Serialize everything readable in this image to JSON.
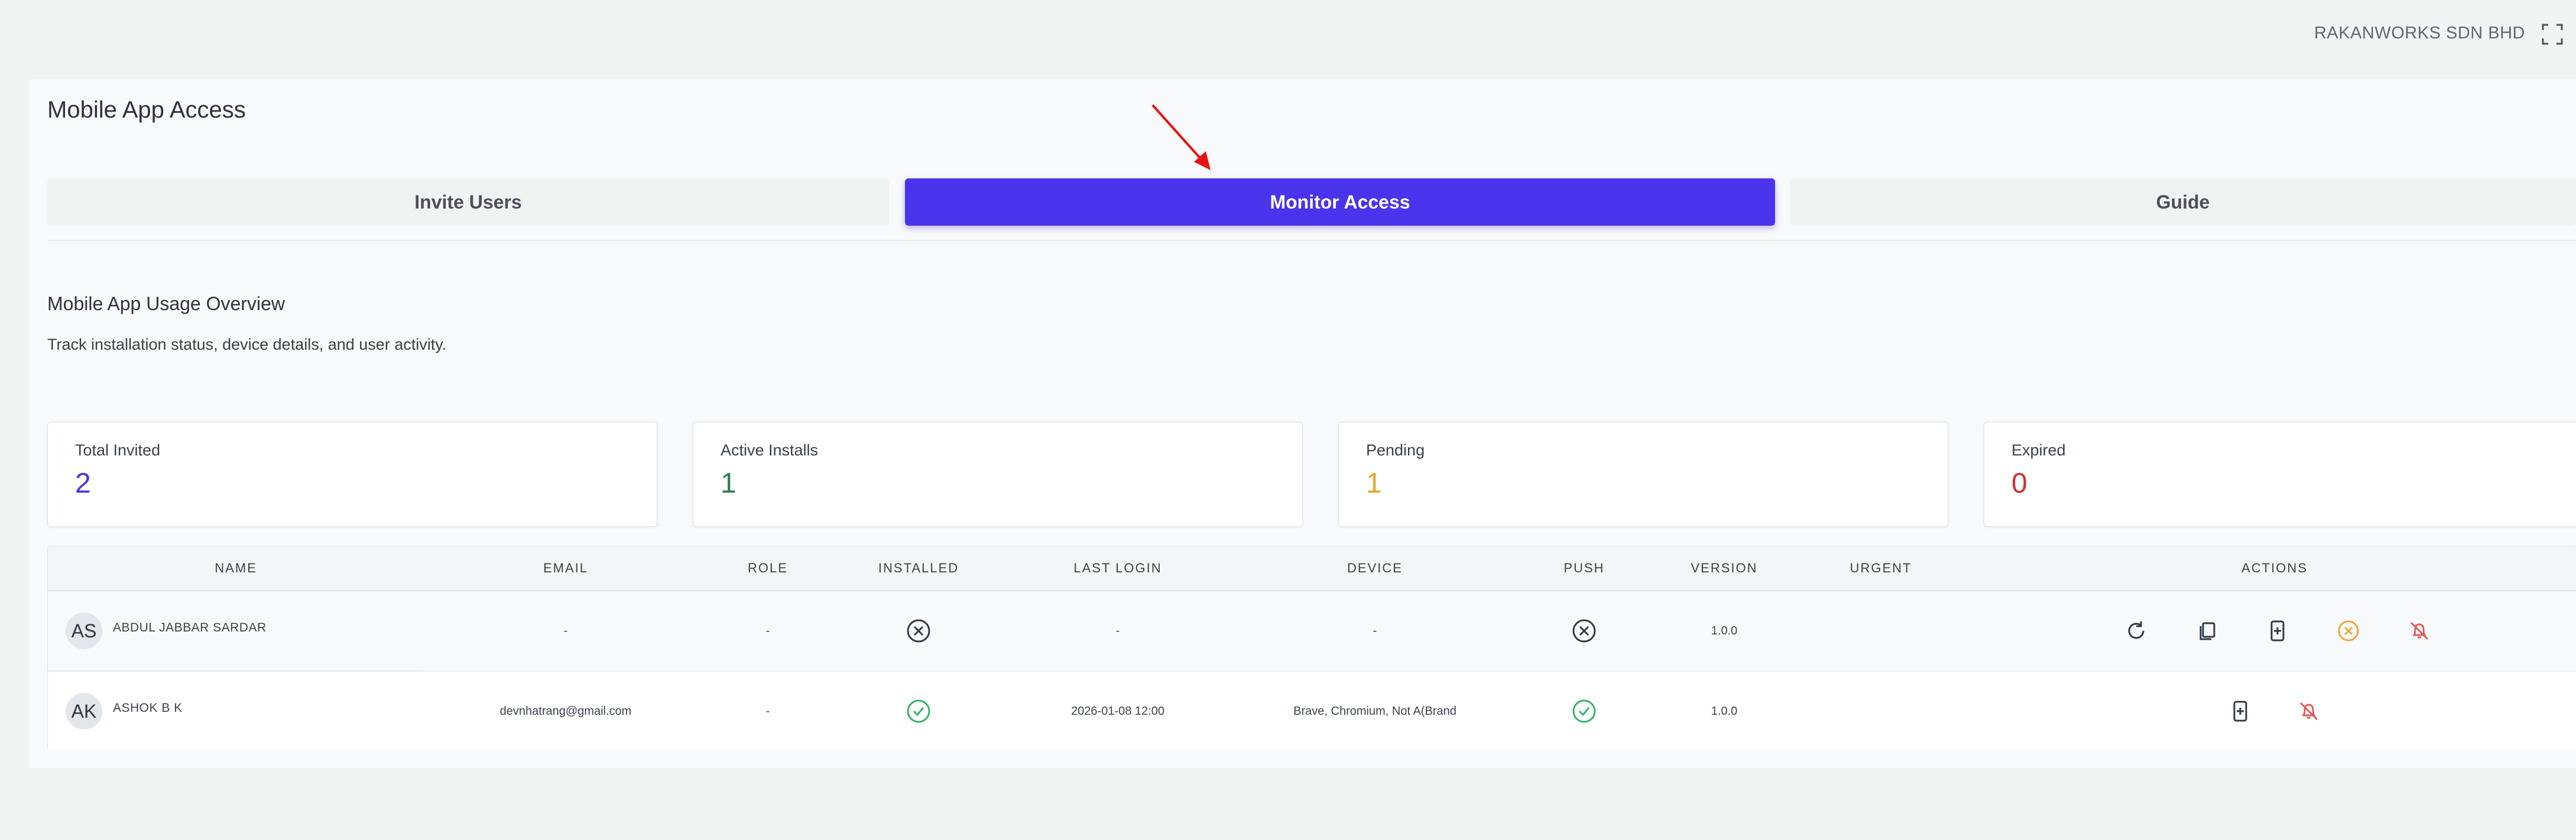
{
  "header": {
    "company": "RAKANWORKS SDN BHD"
  },
  "page": {
    "title": "Mobile App Access"
  },
  "tabs": [
    {
      "label": "Invite Users",
      "active": false
    },
    {
      "label": "Monitor Access",
      "active": true
    },
    {
      "label": "Guide",
      "active": false
    }
  ],
  "overview": {
    "title": "Mobile App Usage Overview",
    "subtitle": "Track installation status, device details, and user activity."
  },
  "stats": [
    {
      "label": "Total Invited",
      "value": "2",
      "color": "#4a33ec"
    },
    {
      "label": "Active Installs",
      "value": "1",
      "color": "#2e7d4f"
    },
    {
      "label": "Pending",
      "value": "1",
      "color": "#e5a823"
    },
    {
      "label": "Expired",
      "value": "0",
      "color": "#d32f2f"
    }
  ],
  "table": {
    "columns": [
      "NAME",
      "EMAIL",
      "ROLE",
      "INSTALLED",
      "LAST LOGIN",
      "DEVICE",
      "PUSH",
      "VERSION",
      "URGENT",
      "ACTIONS"
    ],
    "rows": [
      {
        "initials": "AS",
        "name": "ABDUL JABBAR SARDAR",
        "email": "-",
        "role": "-",
        "installed": "x-circle-icon",
        "last_login": "-",
        "device": "-",
        "push": "x-circle-icon",
        "version": "1.0.0",
        "urgent": "",
        "actions": [
          "refresh-icon",
          "copy-icon",
          "device-add-icon",
          "cancel-circle-icon",
          "bell-off-icon"
        ]
      },
      {
        "initials": "AK",
        "name": "ASHOK B K",
        "email": "devnhatrang@gmail.com",
        "role": "-",
        "installed": "check-circle-icon",
        "last_login": "2026-01-08 12:00",
        "device": "Brave, Chromium, Not A(Brand",
        "push": "check-circle-icon",
        "version": "1.0.0",
        "urgent": "",
        "actions": [
          "device-add-icon",
          "bell-off-icon"
        ]
      }
    ]
  },
  "colors": {
    "accent": "#4a33ec",
    "success": "#34b36a",
    "warning": "#f0a63b",
    "danger": "#e05b5b",
    "annotation_arrow": "#e81010"
  }
}
